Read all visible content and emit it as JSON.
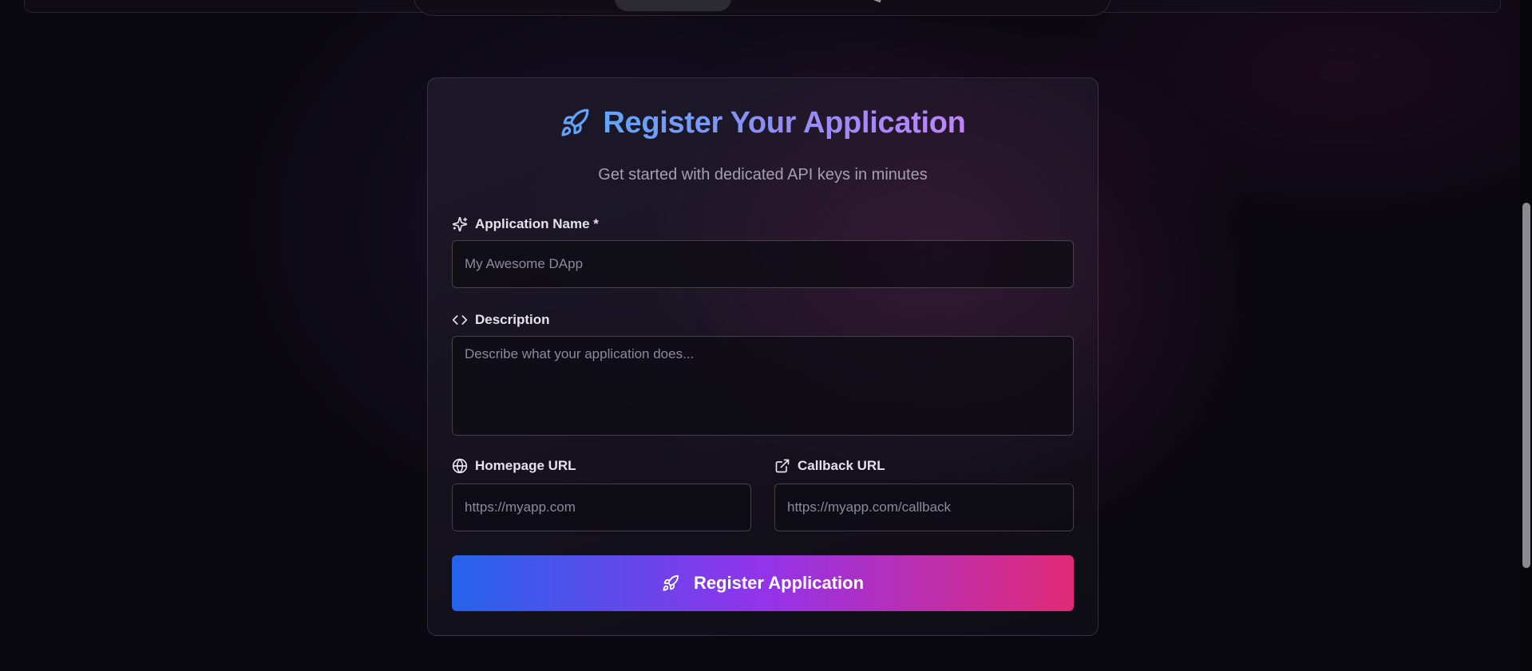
{
  "header": {
    "nav_active_tab": "",
    "nav_overflow_glyph": "chevron-down-icon"
  },
  "form": {
    "title": "Register Your Application",
    "title_icon": "rocket-icon",
    "subtitle": "Get started with dedicated API keys in minutes",
    "fields": {
      "app_name": {
        "label": "Application Name *",
        "icon": "sparkles-icon",
        "value": "",
        "placeholder": "My Awesome DApp"
      },
      "description": {
        "label": "Description",
        "icon": "code-icon",
        "value": "",
        "placeholder": "Describe what your application does..."
      },
      "homepage_url": {
        "label": "Homepage URL",
        "icon": "globe-icon",
        "value": "",
        "placeholder": "https://myapp.com"
      },
      "callback_url": {
        "label": "Callback URL",
        "icon": "external-link-icon",
        "value": "",
        "placeholder": "https://myapp.com/callback"
      }
    },
    "submit": {
      "label": "Register Application",
      "icon": "rocket-icon"
    }
  },
  "colors": {
    "background": "#0a0810",
    "title_gradient": [
      "#60a5fa",
      "#8b8ff6",
      "#c084fc"
    ],
    "button_gradient": [
      "#2563eb",
      "#9333ea",
      "#e12a76"
    ],
    "icon_blue": "#60a5fa"
  }
}
